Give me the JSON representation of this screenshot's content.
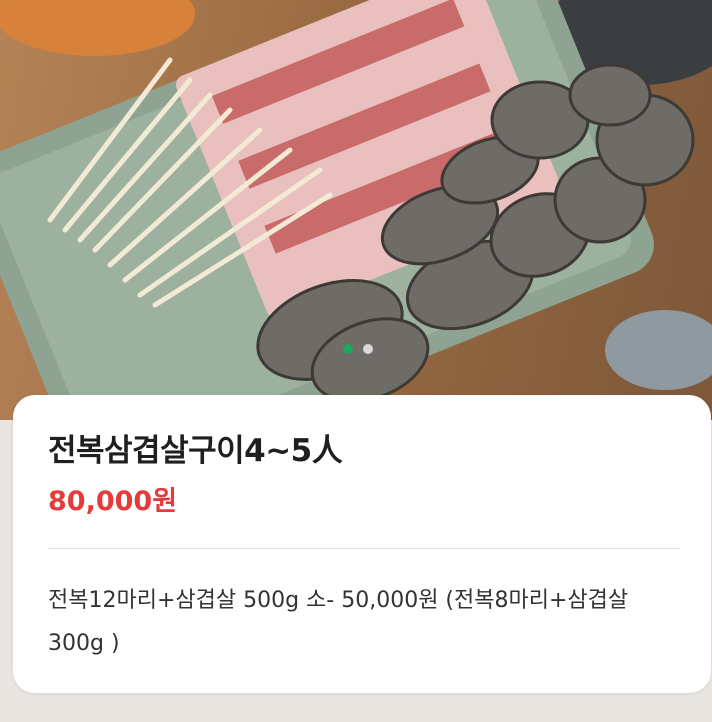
{
  "hero": {
    "image_description": "grilled-food-platter",
    "carousel_total": 2,
    "carousel_active_index": 0,
    "colors": {
      "active_dot": "#1ea65a",
      "inactive_dot": "#d9d9d9"
    }
  },
  "product": {
    "title": "전복삼겹살구이4~5人",
    "price": "80,000원",
    "description": "전복12마리+삼겹살 500g 소- 50,000원 (전복8마리+삼겹살 300g )"
  },
  "colors": {
    "price": "#e63b3b",
    "title": "#1f1f1f"
  }
}
